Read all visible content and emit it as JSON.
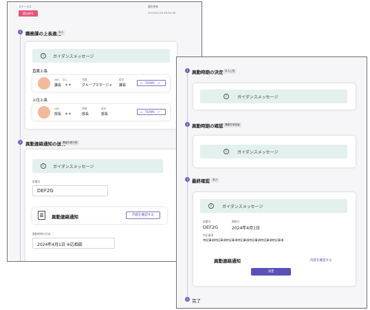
{
  "left": {
    "status_label": "ステータス",
    "status_badge": "提出待ち",
    "status_color": "#e8547a",
    "updated_label": "最終更新",
    "updated_value": "2024/01/16 09:52:38",
    "step1": {
      "number": "1",
      "title": "職務課の上長連絡",
      "tag": "本人",
      "guidance": "ガイダンスメッセージ",
      "direct_boss_heading": "直属上長",
      "direct_boss": {
        "kana": "ABC　なし",
        "name": "課長　＊＊",
        "org_label": "所属",
        "org_value": "グループマネージャ",
        "role_label": "役位",
        "role_value": "課長",
        "teams_label": "TEAMS"
      },
      "upper_boss_heading": "上位上長",
      "upper_boss": {
        "kana": "ABC",
        "name": "部長　＊＊",
        "org_label": "所属",
        "org_value": "部長",
        "role_label": "役位",
        "role_value": "部長",
        "teams_label": "TEAMS"
      }
    },
    "step2": {
      "number": "2",
      "title": "異動連絡通知の送付",
      "tag": "異動先受付係",
      "guidance": "ガイダンスメッセージ",
      "dept_label": "部署名",
      "dept_value": "DEF2G",
      "doc_title": "異動連絡通知",
      "confirm_label": "内容を確認する",
      "date_label": "異動時期の目安",
      "date_value": "2024年4月1日 ※応相談"
    }
  },
  "right": {
    "step1": {
      "number": "1",
      "title": "異動時期の決定",
      "tag": "本人上長",
      "guidance": "ガイダンスメッセージ"
    },
    "step2": {
      "number": "2",
      "title": "異動時期の確認",
      "tag": "異動先承認者",
      "guidance": "ガイダンスメッセージ"
    },
    "step3": {
      "number": "3",
      "title": "最終確認",
      "tag": "本人",
      "guidance": "ガイダンスメッセージ",
      "dept_label": "部署名",
      "dept_value": "DEF2G",
      "date_label": "異動日",
      "date_value": "2024年4月1日",
      "notes_label": "特記事項",
      "notes_value": "特記事項特記事項特記事項特記事項特記事項特記事項特記事項",
      "doc_title": "異動連絡通知",
      "confirm_label": "内容を確認する",
      "submit_label": "決定"
    },
    "done": {
      "number": "4",
      "title": "完了"
    }
  },
  "colors": {
    "accent": "#5b50b6",
    "guidance_bg": "#e3f0ee",
    "badge": "#e8547a"
  }
}
